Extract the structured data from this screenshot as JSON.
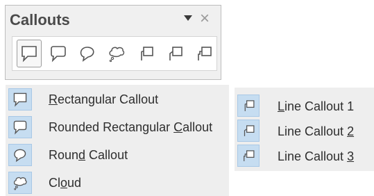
{
  "toolbar": {
    "title": "Callouts",
    "dropdown_icon": "chevron-down-icon",
    "close_glyph": "×",
    "buttons": [
      {
        "icon": "rectangular-callout-icon",
        "selected": true
      },
      {
        "icon": "rounded-rectangular-callout-icon",
        "selected": false
      },
      {
        "icon": "round-callout-icon",
        "selected": false
      },
      {
        "icon": "cloud-callout-icon",
        "selected": false
      },
      {
        "icon": "line-callout-1-icon",
        "selected": false
      },
      {
        "icon": "line-callout-2-icon",
        "selected": false
      },
      {
        "icon": "line-callout-3-icon",
        "selected": false
      }
    ]
  },
  "left_list": [
    {
      "label_before": "",
      "label_accel": "R",
      "label_after": "ectangular Callout",
      "icon": "rectangular-callout-icon"
    },
    {
      "label_before": "Rounded Rectangular ",
      "label_accel": "C",
      "label_after": "allout",
      "icon": "rounded-rectangular-callout-icon"
    },
    {
      "label_before": "Roun",
      "label_accel": "d",
      "label_after": " Callout",
      "icon": "round-callout-icon"
    },
    {
      "label_before": "Cl",
      "label_accel": "o",
      "label_after": "ud",
      "icon": "cloud-callout-icon"
    }
  ],
  "right_list": [
    {
      "label_before": "",
      "label_accel": "L",
      "label_after": "ine Callout 1",
      "icon": "line-callout-1-icon"
    },
    {
      "label_before": "Line Callout ",
      "label_accel": "2",
      "label_after": "",
      "icon": "line-callout-2-icon"
    },
    {
      "label_before": "Line Callout ",
      "label_accel": "3",
      "label_after": "",
      "icon": "line-callout-3-icon"
    }
  ],
  "colors": {
    "icon_highlight": "#c6ddf1",
    "list_background": "#eeeeee",
    "toolbar_background": "#f0f0f0"
  }
}
